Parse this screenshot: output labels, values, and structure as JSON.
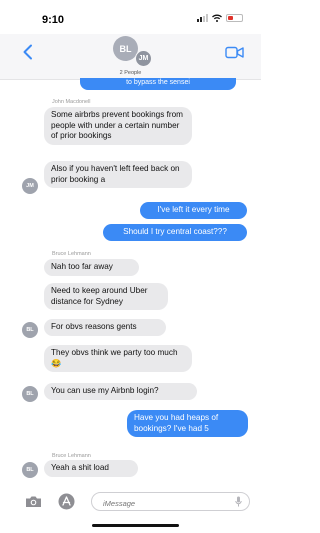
{
  "status": {
    "time": "9:10"
  },
  "header": {
    "avatar_bl": "BL",
    "avatar_jm": "JM",
    "subtitle": "2 People"
  },
  "peek_text": "to bypass the sensei",
  "messages": {
    "m1_sender": "John Macdonell",
    "m1": "Some airbrbs prevent bookings from people with under a certain number of prior bookings",
    "m2": "Also if you haven't left feed back on prior booking a",
    "m2_avatar": "JM",
    "m3": "I've left it every time",
    "m4": "Should I try central coast???",
    "m5_sender": "Bruce Lehmann",
    "m5": "Nah too far away",
    "m6": "Need to keep around Uber distance for Sydney",
    "m7": "For obvs reasons gents",
    "m7_avatar": "BL",
    "m8": "They obvs think we party too much 😂",
    "m9": "You can use my Airbnb login?",
    "m9_avatar": "BL",
    "m10": "Have you had heaps of bookings? I've had 5",
    "m11_sender": "Bruce Lehmann",
    "m11": "Yeah a shit load",
    "m11_avatar": "BL"
  },
  "composer": {
    "placeholder": "iMessage"
  },
  "colors": {
    "accent": "#3b8af5",
    "incoming": "#e9e9eb"
  }
}
